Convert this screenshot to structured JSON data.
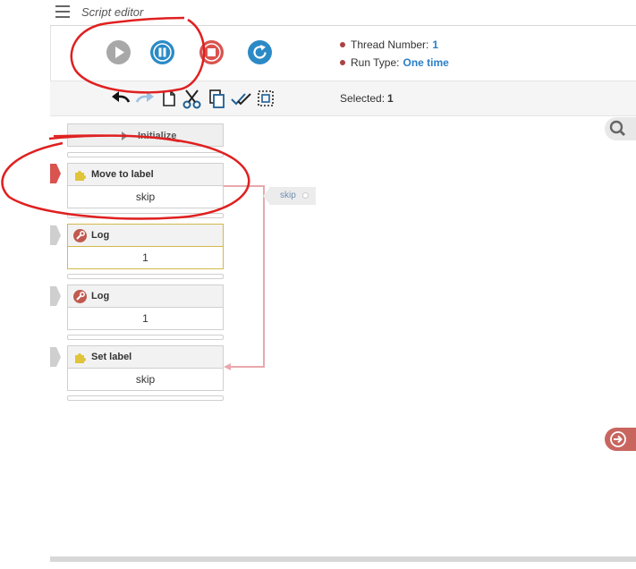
{
  "header": {
    "title": "Script editor"
  },
  "controls": {
    "play_icon": "play-icon",
    "pause_icon": "pause-icon",
    "stop_icon": "stop-icon",
    "restart_icon": "restart-icon"
  },
  "info": {
    "thread_label": "Thread Number:",
    "thread_value": "1",
    "run_type_label": "Run Type:",
    "run_type_value": "One time"
  },
  "toolbar": {
    "selected_label": "Selected:",
    "selected_value": "1"
  },
  "blocks": [
    {
      "label": "Initialize"
    },
    {
      "label": "Move to label",
      "value": "skip",
      "icon": "puzzle-icon"
    },
    {
      "label": "Log",
      "value": "1",
      "icon": "wrench-icon"
    },
    {
      "label": "Log",
      "value": "1",
      "icon": "wrench-icon"
    },
    {
      "label": "Set label",
      "value": "skip",
      "icon": "puzzle-icon"
    }
  ],
  "skip_tag": {
    "label": "skip"
  },
  "colors": {
    "accent": "#2a7fc6",
    "play": "#a8a8a8",
    "pause": "#2b8ac6",
    "stop": "#d9534f",
    "annotation": "#e02020",
    "link_line": "#e8a8ac"
  }
}
